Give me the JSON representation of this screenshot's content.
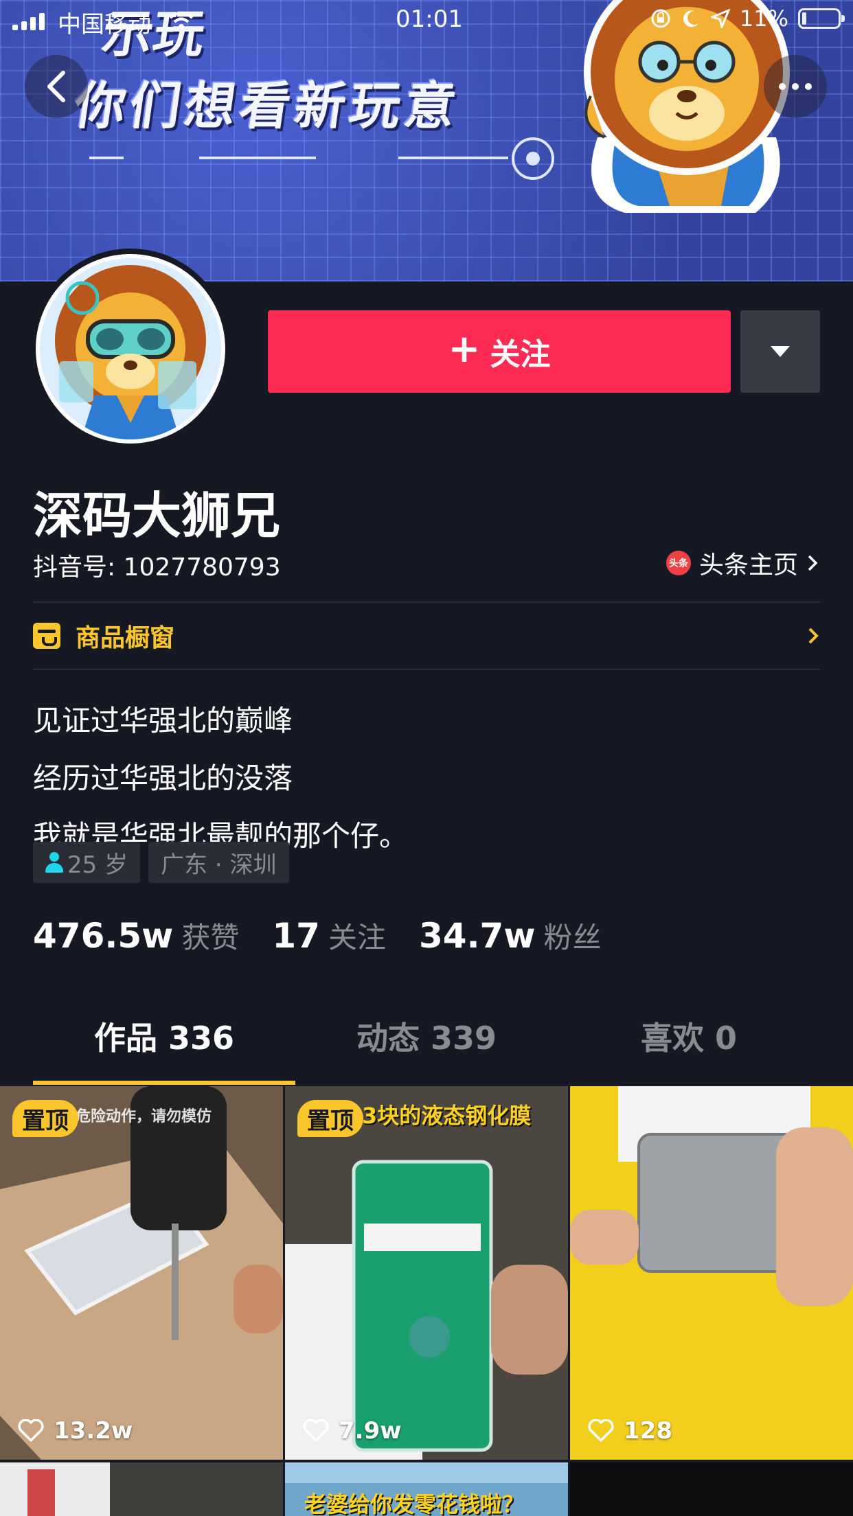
{
  "status_bar": {
    "carrier": "中国移动",
    "time": "01:01",
    "battery": "11%"
  },
  "banner": {
    "line1": "示玩",
    "line2": "你们想看新玩意"
  },
  "profile": {
    "follow_label": "关注",
    "name": "深码大狮兄",
    "douyin_id": "抖音号: 1027780793",
    "toutiao_badge": "头条",
    "toutiao_label": "头条主页",
    "shop_label": "商品橱窗",
    "bio": [
      "见证过华强北的巅峰",
      "经历过华强北的没落",
      "我就是华强北最靓的那个仔。"
    ],
    "tags": {
      "age": "25 岁",
      "location": "广东 · 深圳"
    },
    "stats": [
      {
        "num": "476.5w",
        "label": "获赞"
      },
      {
        "num": "17",
        "label": "关注"
      },
      {
        "num": "34.7w",
        "label": "粉丝"
      }
    ]
  },
  "tabs": [
    {
      "label": "作品 336",
      "active": true
    },
    {
      "label": "动态 339",
      "active": false
    },
    {
      "label": "喜欢 0",
      "active": false
    }
  ],
  "videos": [
    {
      "pinned": true,
      "pin_label": "置顶",
      "caption": "危险动作，请勿模仿",
      "likes": "13.2w"
    },
    {
      "pinned": true,
      "pin_label": "置顶",
      "caption": "3块的液态钢化膜",
      "likes": "7.9w"
    },
    {
      "pinned": false,
      "pin_label": "",
      "caption": "",
      "likes": "128"
    },
    {
      "pinned": false,
      "pin_label": "",
      "caption": "",
      "likes": ""
    },
    {
      "pinned": false,
      "pin_label": "",
      "caption": "老婆给你发零花钱啦？",
      "likes": ""
    },
    {
      "pinned": false,
      "pin_label": "",
      "caption": "",
      "likes": ""
    }
  ],
  "colors": {
    "background": "#161823",
    "follow": "#fe2c55",
    "accent_yellow": "#fbc62c",
    "muted_text": "#8a8b91"
  },
  "icons": [
    "back-chevron-icon",
    "more-dots-icon",
    "wifi-icon",
    "lock-rotation-icon",
    "moon-icon",
    "location-arrow-icon",
    "battery-icon",
    "dropdown-triangle-icon",
    "shop-icon",
    "person-icon",
    "heart-icon"
  ]
}
